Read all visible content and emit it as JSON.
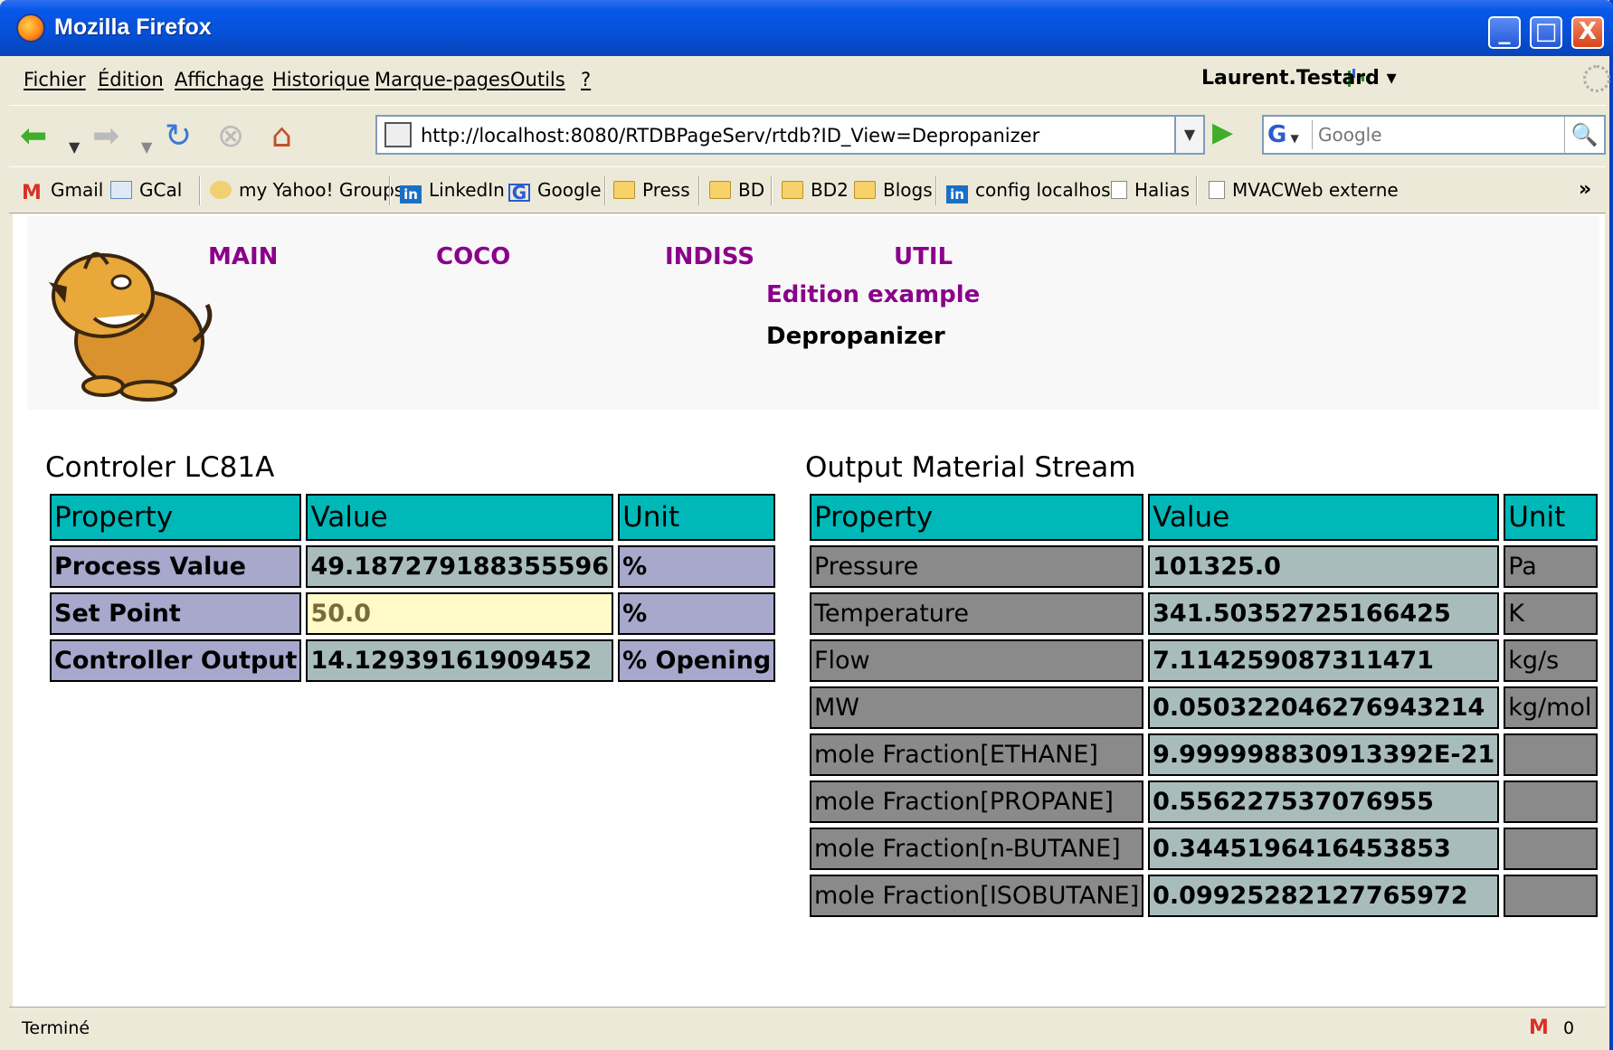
{
  "window": {
    "title": "Mozilla Firefox",
    "controls": {
      "minimize": "_",
      "maximize": "□",
      "close": "X"
    }
  },
  "menubar": {
    "items": [
      {
        "label": "Fichier"
      },
      {
        "label": "Édition"
      },
      {
        "label": "Affichage"
      },
      {
        "label": "Historique"
      },
      {
        "label": "Marque-pages"
      },
      {
        "label": "Outils"
      },
      {
        "label": "?"
      }
    ],
    "user": "Laurent.Testard"
  },
  "navbar": {
    "url": "http://localhost:8080/RTDBPageServ/rtdb?ID_View=Depropanizer",
    "search_placeholder": "Google",
    "search_engine": "G",
    "icons": {
      "back": "back-arrow-icon",
      "forward": "forward-arrow-icon",
      "reload": "reload-icon",
      "stop": "stop-icon",
      "home": "home-icon"
    }
  },
  "bookmarks": [
    {
      "label": "Gmail",
      "icon": "gmail-icon"
    },
    {
      "label": "GCal",
      "icon": "calendar-icon"
    },
    {
      "label": "my Yahoo! Groups",
      "icon": "yahoo-groups-icon"
    },
    {
      "label": "LinkedIn",
      "icon": "linkedin-icon"
    },
    {
      "label": "Google",
      "icon": "google-icon"
    },
    {
      "label": "Press",
      "icon": "folder-icon"
    },
    {
      "label": "BD",
      "icon": "folder-icon"
    },
    {
      "label": "BD2",
      "icon": "folder-icon"
    },
    {
      "label": "Blogs",
      "icon": "folder-icon"
    },
    {
      "label": "config localhost",
      "icon": "linkedin-icon"
    },
    {
      "label": "Halias",
      "icon": "page-icon"
    },
    {
      "label": "MVACWeb externe",
      "icon": "page-icon"
    }
  ],
  "page": {
    "nav": {
      "main": "MAIN",
      "coco": "COCO",
      "indiss": "INDISS",
      "util": "UTIL",
      "edition_example": "Edition example",
      "current": "Depropanizer"
    },
    "controller": {
      "title": "Controler LC81A",
      "headers": [
        "Property",
        "Value",
        "Unit"
      ],
      "rows": [
        {
          "property": "Process Value",
          "value": "49.187279188355596",
          "unit": "%"
        },
        {
          "property": "Set Point",
          "value": "50.0",
          "unit": "%"
        },
        {
          "property": "Controller Output",
          "value": "14.12939161909452",
          "unit": "% Opening"
        }
      ]
    },
    "stream": {
      "title": "Output Material Stream",
      "headers": [
        "Property",
        "Value",
        "Unit"
      ],
      "rows": [
        {
          "property": "Pressure",
          "value": "101325.0",
          "unit": "Pa"
        },
        {
          "property": "Temperature",
          "value": "341.50352725166425",
          "unit": "K"
        },
        {
          "property": "Flow",
          "value": "7.114259087311471",
          "unit": "kg/s"
        },
        {
          "property": "MW",
          "value": "0.050322046276943214",
          "unit": "kg/mol"
        },
        {
          "property": "mole Fraction[ETHANE]",
          "value": "9.999998830913392E-21",
          "unit": ""
        },
        {
          "property": "mole Fraction[PROPANE]",
          "value": "0.556227537076955",
          "unit": ""
        },
        {
          "property": "mole Fraction[n-BUTANE]",
          "value": "0.3445196416453853",
          "unit": ""
        },
        {
          "property": "mole Fraction[ISOBUTANE]",
          "value": "0.09925282127765972",
          "unit": ""
        }
      ]
    }
  },
  "statusbar": {
    "text": "Terminé",
    "mail_count": "0"
  },
  "colors": {
    "header_cell": "#00b8b8",
    "left_prop_cell": "#a8a8cc",
    "value_cell": "#a8bcbc",
    "right_prop_cell": "#8a8a8a",
    "nav_link": "#8a008a",
    "input_cell": "#fffac8"
  }
}
